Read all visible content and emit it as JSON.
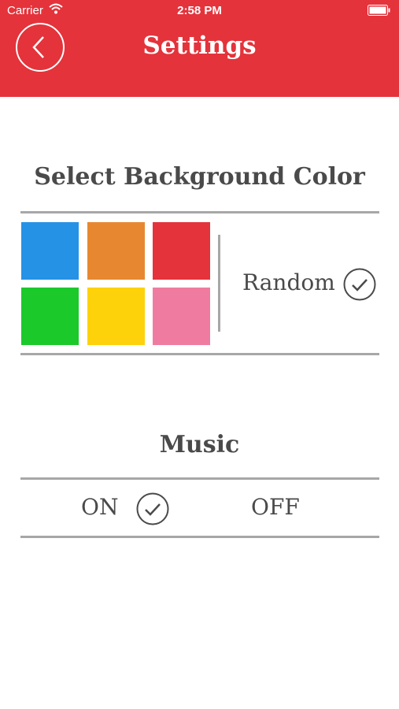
{
  "status_bar": {
    "carrier": "Carrier",
    "time": "2:58 PM"
  },
  "header": {
    "title": "Settings",
    "color": "#e4333b"
  },
  "background_section": {
    "heading": "Select Background Color",
    "swatches": [
      {
        "name": "blue",
        "color": "#2592e6"
      },
      {
        "name": "orange",
        "color": "#e78830"
      },
      {
        "name": "red",
        "color": "#e4333b"
      },
      {
        "name": "green",
        "color": "#1bc92b"
      },
      {
        "name": "yellow",
        "color": "#fdd20b"
      },
      {
        "name": "pink",
        "color": "#ef7ca0"
      }
    ],
    "random_label": "Random",
    "random_selected": true
  },
  "music_section": {
    "heading": "Music",
    "on_label": "ON",
    "off_label": "OFF",
    "selected": "ON"
  },
  "icons": {
    "back": "chevron-left-icon",
    "check": "check-circle-icon",
    "wifi": "wifi-icon",
    "battery": "battery-icon"
  }
}
